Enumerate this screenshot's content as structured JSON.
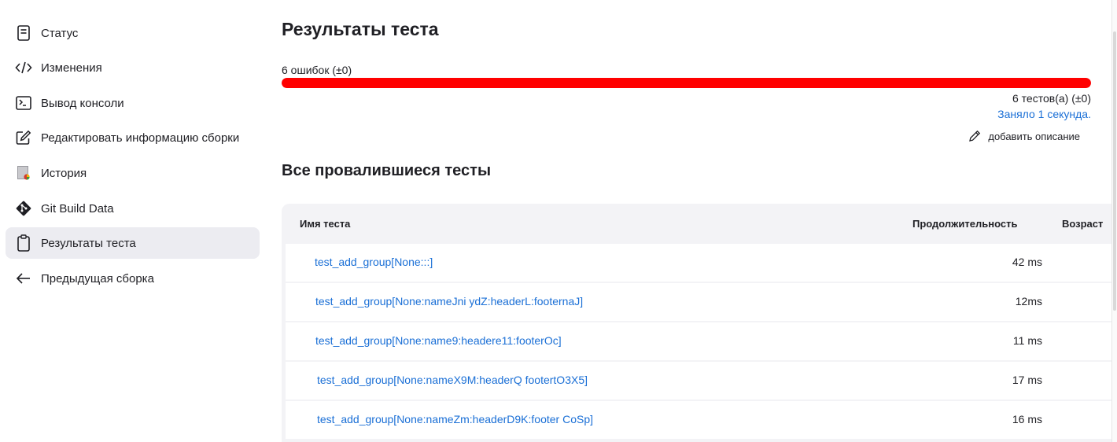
{
  "sidebar": {
    "items": [
      {
        "label": "Статус",
        "icon": "document-icon"
      },
      {
        "label": "Изменения",
        "icon": "code-icon"
      },
      {
        "label": "Вывод консоли",
        "icon": "terminal-icon"
      },
      {
        "label": "Редактировать информацию сборки",
        "icon": "edit-icon"
      },
      {
        "label": "История",
        "icon": "history-icon"
      },
      {
        "label": "Git Build Data",
        "icon": "git-icon"
      },
      {
        "label": "Результаты теста",
        "icon": "clipboard-icon",
        "active": true
      },
      {
        "label": "Предыдущая сборка",
        "icon": "arrow-left-icon"
      }
    ]
  },
  "main": {
    "title": "Результаты теста",
    "fail_summary": "6 ошибок (±0)",
    "fail_fraction": 1.0,
    "tests_total": "6 тестов(а) (±0)",
    "took": "Заняло 1 секунда.",
    "add_description": "добавить описание",
    "section_title": "Все провалившиеся тесты"
  },
  "table": {
    "headers": {
      "name": "Имя теста",
      "duration": "Продолжительность",
      "age": "Возраст"
    },
    "rows": [
      {
        "name": "test_add_group[None:::]",
        "duration": "42 ms"
      },
      {
        "name": "test_add_group[None:nameJni ydZ:headerL:footernaJ]",
        "duration": "12ms"
      },
      {
        "name": "test_add_group[None:name9:headere11:footerOc]",
        "duration": "11 ms"
      },
      {
        "name": "test_add_group[None:nameX9M:headerQ footertO3X5]",
        "duration": "17 ms"
      },
      {
        "name": "test_add_group[None:nameZm:headerD9K:footer CoSp]",
        "duration": "16 ms"
      }
    ]
  },
  "colors": {
    "accent_link": "#1a6fd6",
    "fail_bar": "#ff0000",
    "active_bg": "#ececf1"
  }
}
